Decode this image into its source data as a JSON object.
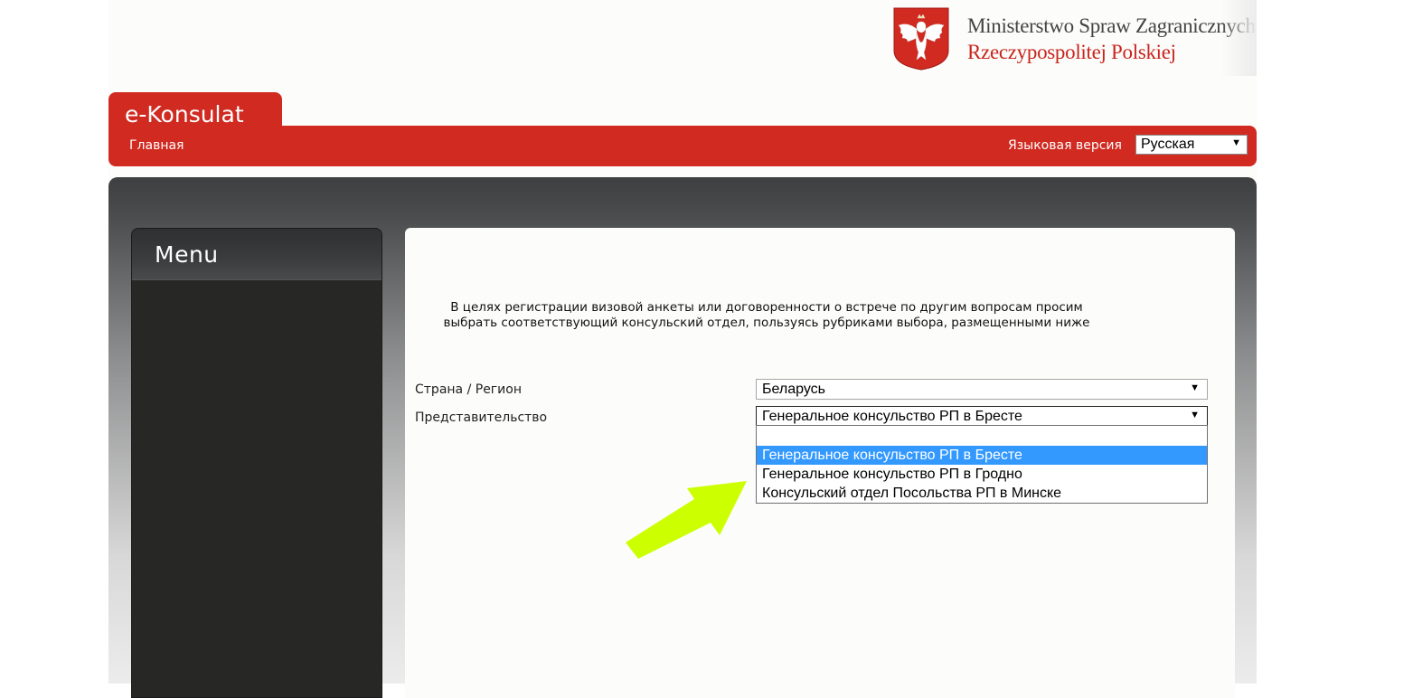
{
  "header": {
    "ministry_line1": "Ministerstwo Spraw Zagranicznych",
    "ministry_line2": "Rzeczypospolitej Polskiej",
    "emblem": "polish-eagle-emblem"
  },
  "app": {
    "title": "e-Konsulat"
  },
  "nav": {
    "home": "Главная",
    "language_label": "Языковая версия",
    "language_value": "Русская"
  },
  "menu": {
    "title": "Menu"
  },
  "content": {
    "intro_line1": "В целях регистрации визовой анкеты или договоренности о встрече по другим вопросам просим",
    "intro_line2": "выбрать соответствующий консульский отдел, пользуясь рубриками выбора, размещенными ниже",
    "country_label": "Страна / Регион",
    "country_value": "Беларусь",
    "office_label": "Представительство",
    "office_value": "Генеральное консульство РП в Бресте",
    "office_options": [
      "",
      "Генеральное консульство РП в Бресте",
      "Генеральное консульство РП в Гродно",
      "Консульский отдел Посольства РП в Минске"
    ],
    "selected_option_index": 1
  },
  "colors": {
    "brand_red": "#d02a21",
    "highlight_blue": "#3399ff",
    "pointer_green": "#ccff00",
    "menu_dark": "#272725"
  },
  "icons": {
    "dropdown_arrow": "triangle-down-icon",
    "pointer": "green-arrow-pointer"
  }
}
